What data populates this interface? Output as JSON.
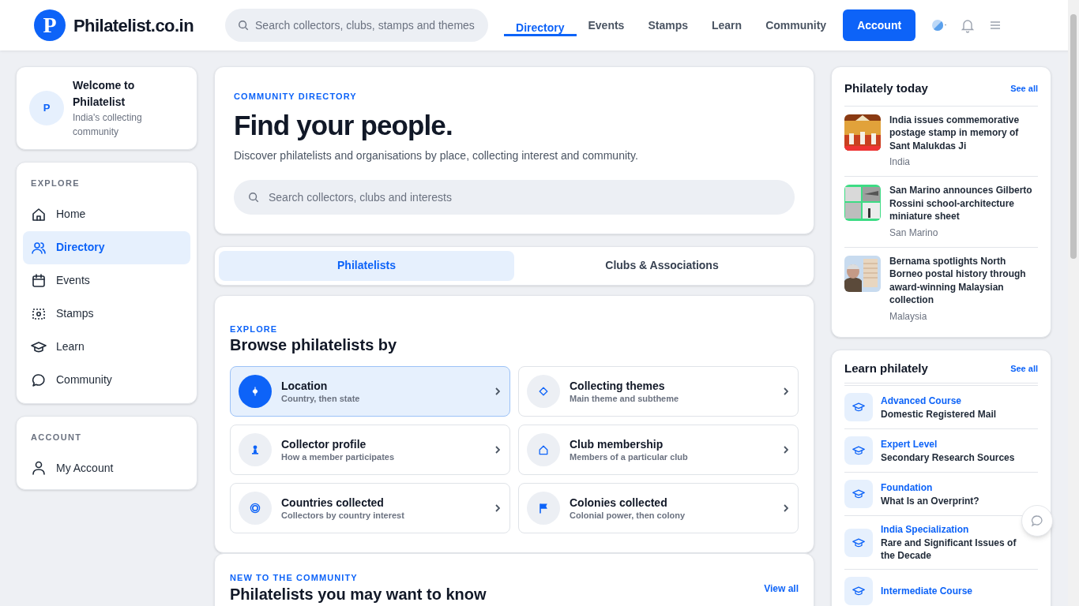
{
  "header": {
    "logo_letter": "P",
    "brand": "Philatelist.co.in",
    "search": {
      "placeholder": "Search collectors, clubs, stamps and themes"
    },
    "nav": [
      {
        "label": "Directory",
        "selected": true
      },
      {
        "label": "Events",
        "selected": false
      },
      {
        "label": "Stamps",
        "selected": false
      },
      {
        "label": "Learn",
        "selected": false
      },
      {
        "label": "Community",
        "selected": false
      }
    ],
    "account_button": "Account"
  },
  "sidebar": {
    "welcome": {
      "avatar": "P",
      "title": "Welcome to Philatelist",
      "subtitle": "India's collecting community"
    },
    "explore": {
      "heading": "EXPLORE",
      "items": [
        {
          "label": "Home",
          "selected": false
        },
        {
          "label": "Directory",
          "selected": true
        },
        {
          "label": "Events",
          "selected": false
        },
        {
          "label": "Stamps",
          "selected": false
        },
        {
          "label": "Learn",
          "selected": false
        },
        {
          "label": "Community",
          "selected": false
        }
      ]
    },
    "account": {
      "heading": "ACCOUNT",
      "items": [
        {
          "label": "My Account",
          "selected": false
        }
      ]
    }
  },
  "hero": {
    "eyebrow": "COMMUNITY DIRECTORY",
    "title": "Find your people.",
    "description": "Discover philatelists and organisations by place, collecting interest and community.",
    "search": {
      "placeholder": "Search collectors, clubs and interests"
    }
  },
  "tabs": [
    {
      "label": "Philatelists",
      "selected": true
    },
    {
      "label": "Clubs & Associations",
      "selected": false
    }
  ],
  "browse": {
    "eyebrow": "EXPLORE",
    "title": "Browse philatelists by",
    "options": [
      {
        "title": "Location",
        "subtitle": "Country, then state",
        "selected": true
      },
      {
        "title": "Collecting themes",
        "subtitle": "Main theme and subtheme",
        "selected": false
      },
      {
        "title": "Collector profile",
        "subtitle": "How a member participates",
        "selected": false
      },
      {
        "title": "Club membership",
        "subtitle": "Members of a particular club",
        "selected": false
      },
      {
        "title": "Countries collected",
        "subtitle": "Collectors by country interest",
        "selected": false
      },
      {
        "title": "Colonies collected",
        "subtitle": "Colonial power, then colony",
        "selected": false
      }
    ]
  },
  "new_members": {
    "eyebrow": "NEW TO THE COMMUNITY",
    "title": "Philatelists you may want to know",
    "link": "View all"
  },
  "news": {
    "title": "Philately today",
    "see_all": "See all",
    "items": [
      {
        "headline": "India issues commemorative postage stamp in memory of Sant Malukdas Ji",
        "place": "India",
        "kind": "picture"
      },
      {
        "headline": "San Marino announces Gilberto Rossini school-architecture miniature sheet",
        "place": "San Marino",
        "kind": "picture"
      },
      {
        "headline": "Bernama spotlights North Borneo postal history through award-winning Malaysian collection",
        "place": "Malaysia",
        "kind": "picture"
      }
    ]
  },
  "learn": {
    "title": "Learn philately",
    "see_all": "See all",
    "items": [
      {
        "level": "Advanced Course",
        "title": "Domestic Registered Mail"
      },
      {
        "level": "Expert Level",
        "title": "Secondary Research Sources"
      },
      {
        "level": "Foundation",
        "title": "What Is an Overprint?"
      },
      {
        "level": "India Specialization",
        "title": "Rare and Significant Issues of the Decade"
      },
      {
        "level": "Intermediate Course"
      }
    ]
  }
}
